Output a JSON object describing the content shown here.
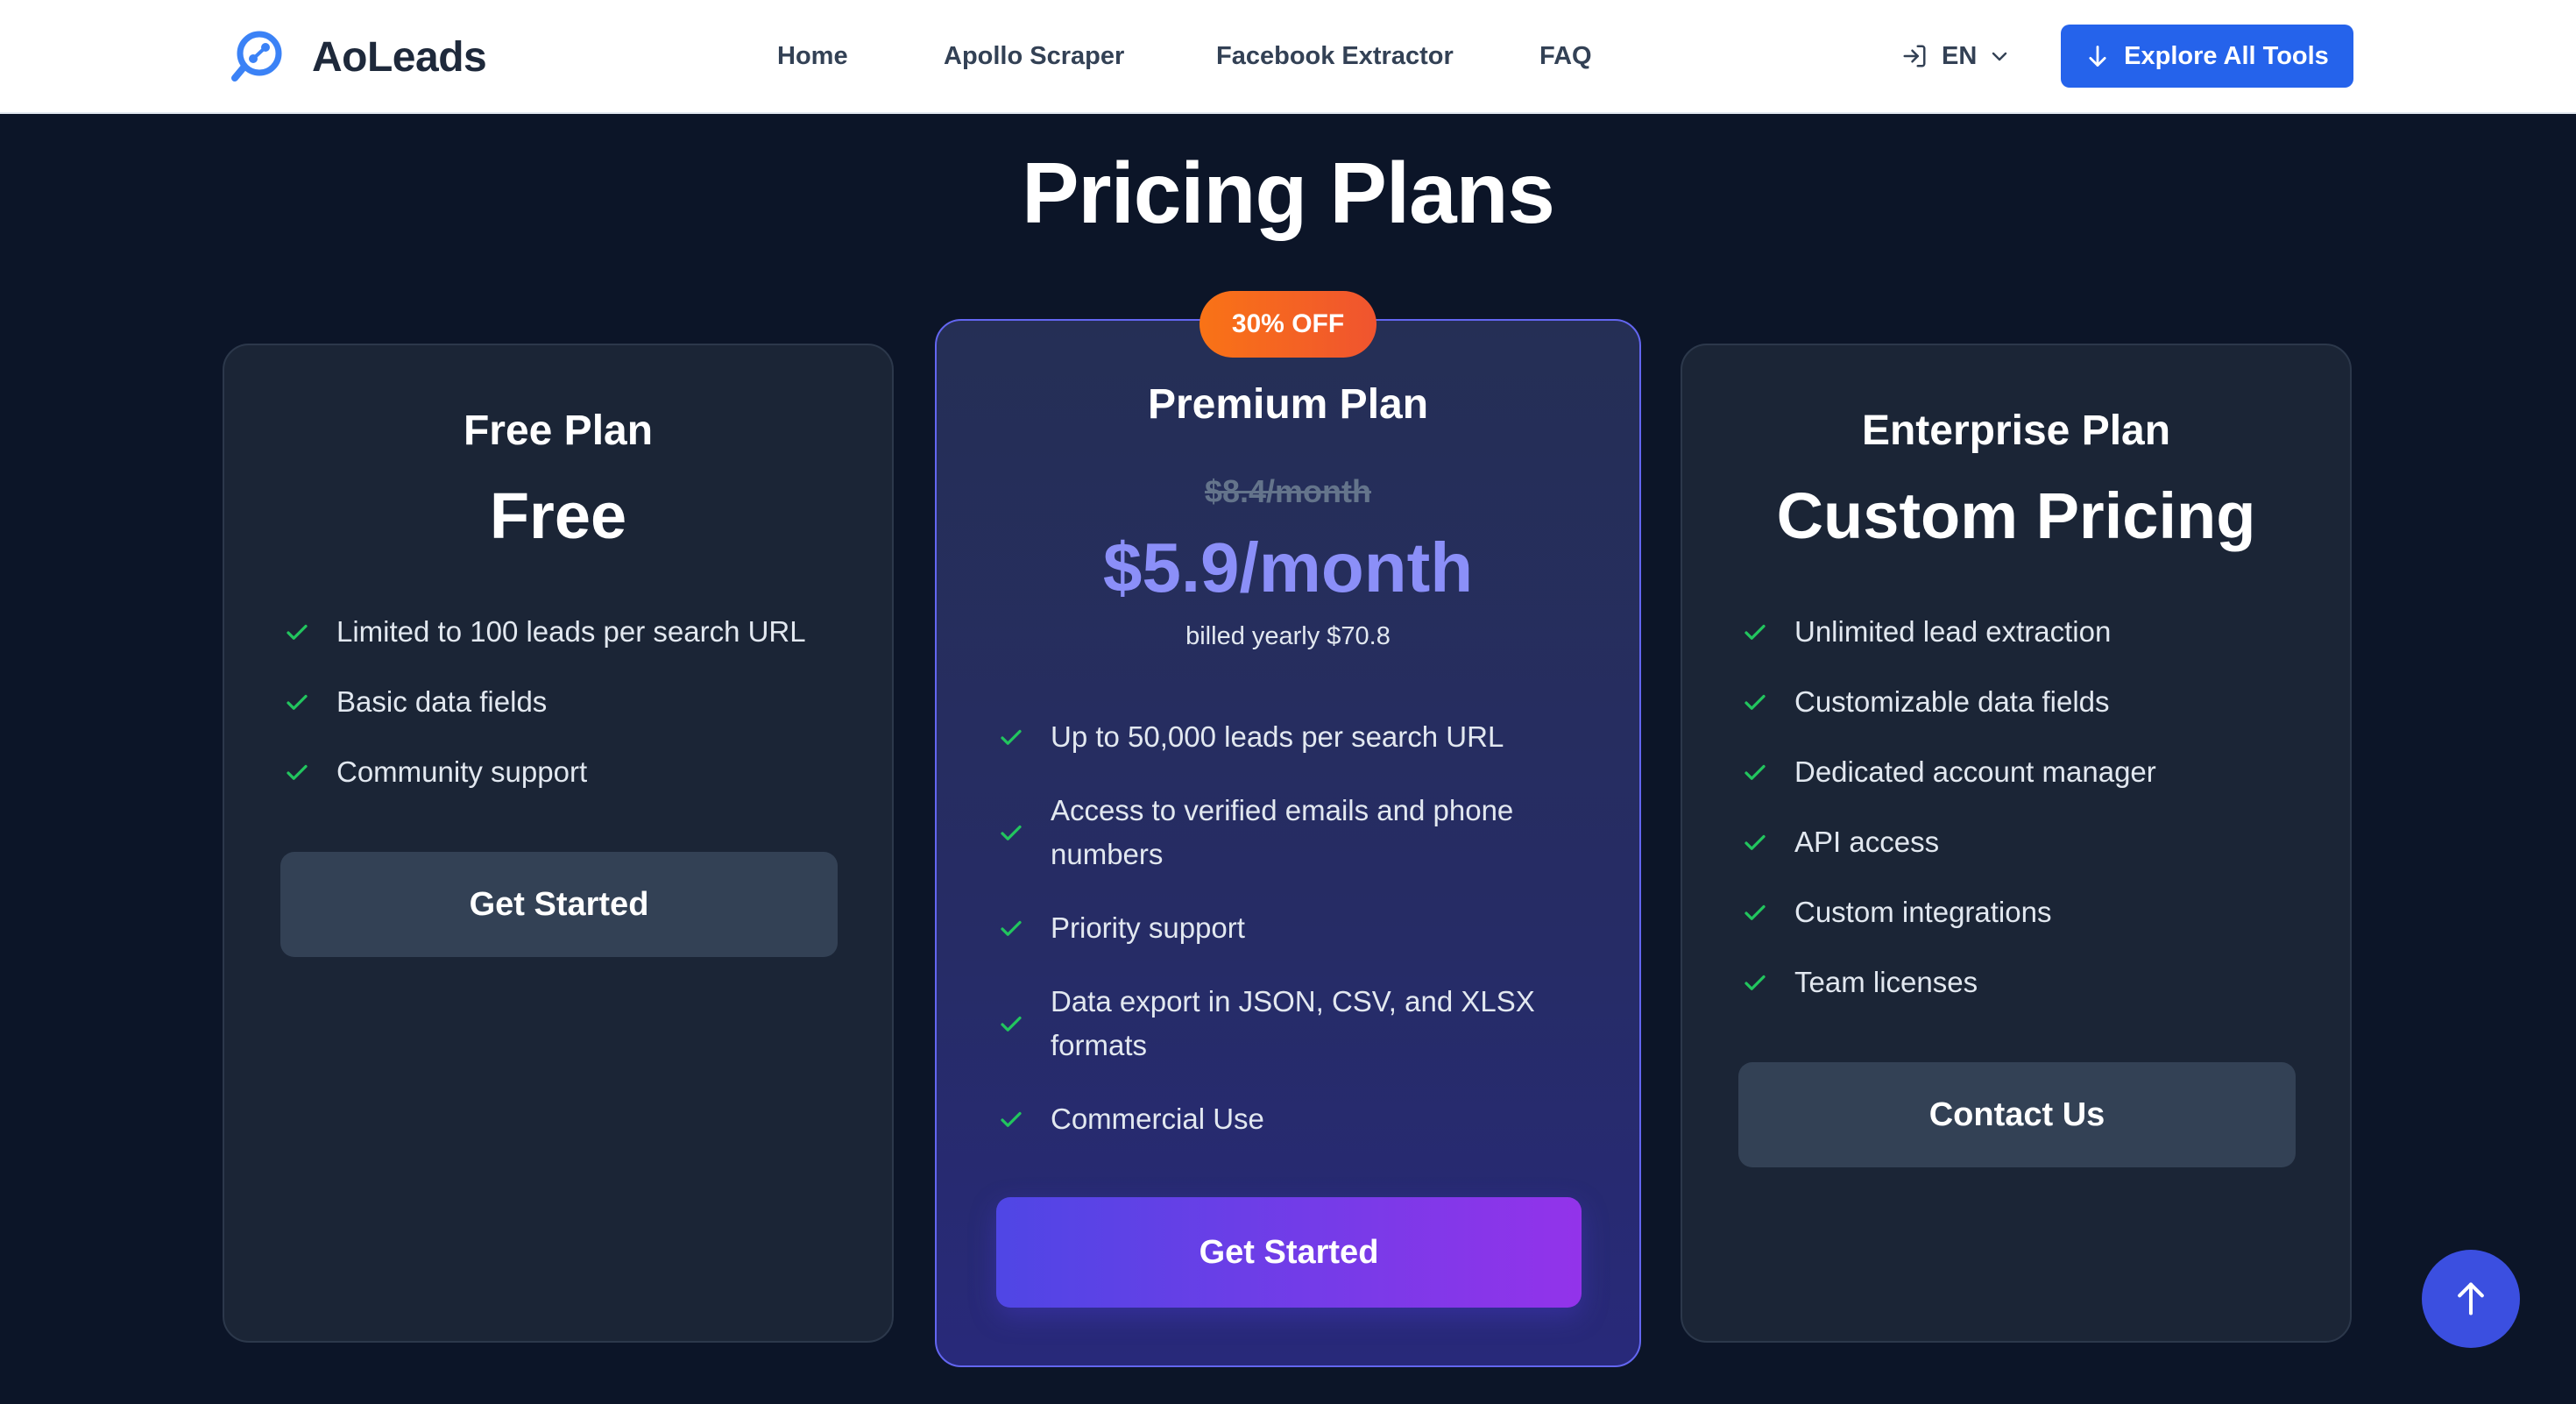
{
  "header": {
    "brand": "AoLeads",
    "nav": [
      "Home",
      "Apollo Scraper",
      "Facebook Extractor",
      "FAQ"
    ],
    "language": "EN",
    "explore_label": "Explore All Tools"
  },
  "page_title": "Pricing Plans",
  "plans": {
    "free": {
      "name": "Free Plan",
      "price": "Free",
      "features": [
        "Limited to 100 leads per search URL",
        "Basic data fields",
        "Community support"
      ],
      "cta": "Get Started"
    },
    "premium": {
      "badge": "30% OFF",
      "name": "Premium Plan",
      "old_price": "$8.4/month",
      "price": "$5.9/month",
      "billed": "billed yearly $70.8",
      "features": [
        "Up to 50,000 leads per search URL",
        "Access to verified emails and phone numbers",
        "Priority support",
        "Data export in JSON, CSV, and XLSX formats",
        "Commercial Use"
      ],
      "cta": "Get Started"
    },
    "enterprise": {
      "name": "Enterprise Plan",
      "price": "Custom Pricing",
      "features": [
        "Unlimited lead extraction",
        "Customizable data fields",
        "Dedicated account manager",
        "API access",
        "Custom integrations",
        "Team licenses"
      ],
      "cta": "Contact Us"
    }
  },
  "colors": {
    "accent": "#2563eb",
    "check": "#22c55e",
    "premium_price": "#8b8ff8",
    "badge": "#f97316",
    "background": "#0c1528"
  },
  "icons": [
    "logo-icon",
    "login-icon",
    "chevron-down-icon",
    "arrow-down-icon",
    "check-icon",
    "arrow-up-icon"
  ]
}
